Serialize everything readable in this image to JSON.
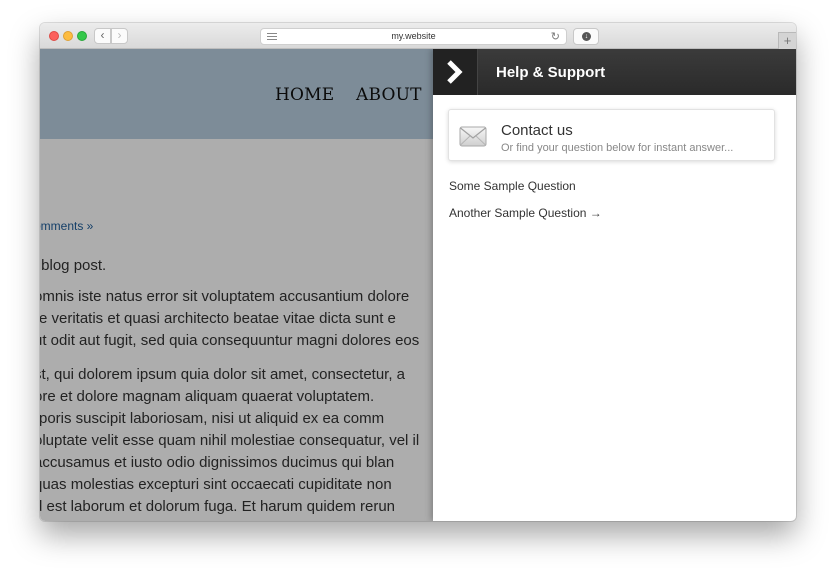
{
  "browser": {
    "url": "my.website",
    "back_glyph": "‹",
    "forward_glyph": "›",
    "reload_glyph": "↻",
    "download_glyph": "↓",
    "new_tab_glyph": "+",
    "icons": [
      "reader-icon",
      "reload-icon",
      "download-icon",
      "new-tab-icon"
    ]
  },
  "site": {
    "nav": {
      "home": "HOME",
      "about": "ABOUT"
    },
    "header_color": "#b8cfe0",
    "article": {
      "comments_link": "omments »",
      "intro": "r blog post.",
      "paragraph_1": [
        "omnis iste natus error sit voluptatem accusantium dolore",
        "re veritatis et quasi architecto beatae vitae dicta sunt e",
        "ut odit aut fugit, sed quia consequuntur magni dolores eos"
      ],
      "paragraph_2": [
        "st, qui dolorem ipsum quia dolor sit amet, consectetur, a",
        "ore et dolore magnam aliquam quaerat voluptatem.",
        "rporis suscipit laboriosam, nisi ut aliquid ex ea comm",
        "oluptate velit esse quam nihil molestiae consequatur, vel il",
        " accusamus et iusto odio dignissimos ducimus qui blan",
        " quas molestias excepturi sint occaecati cupiditate non",
        "d est laborum et dolorum fuga. Et harum quidem rerun"
      ]
    }
  },
  "help_panel": {
    "title": "Help & Support",
    "collapse_icon": "chevron-right-icon",
    "contact": {
      "title": "Contact us",
      "subtitle": "Or find your question below for instant answer...",
      "icon": "envelope-icon"
    },
    "questions": [
      "Some Sample Question",
      "Another Sample Question →"
    ]
  },
  "colors": {
    "link": "#1e5d9a",
    "panel_header": "#2f2f2f"
  }
}
